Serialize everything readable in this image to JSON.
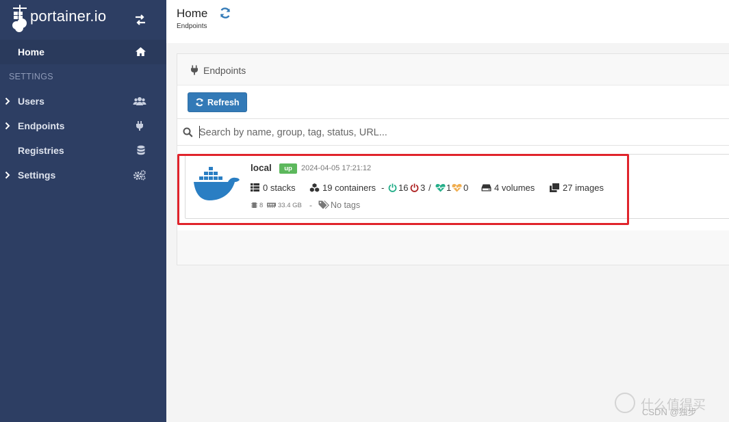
{
  "brand": {
    "name": "portainer.io"
  },
  "sidebar": {
    "home_label": "Home",
    "settings_header": "SETTINGS",
    "items": [
      {
        "label": "Users",
        "icon": "users-icon",
        "expandable": true
      },
      {
        "label": "Endpoints",
        "icon": "plug-icon",
        "expandable": true
      },
      {
        "label": "Registries",
        "icon": "database-icon",
        "expandable": false
      },
      {
        "label": "Settings",
        "icon": "cogs-icon",
        "expandable": true
      }
    ]
  },
  "header": {
    "title": "Home",
    "breadcrumb": "Endpoints"
  },
  "panel": {
    "title": "Endpoints",
    "refresh_label": "Refresh",
    "search_placeholder": "Search by name, group, tag, status, URL..."
  },
  "endpoint": {
    "name": "local",
    "status": "up",
    "timestamp": "2024-04-05 17:21:12",
    "stacks": "0 stacks",
    "containers": "19 containers",
    "separator": "-",
    "running": "16",
    "stopped": "3",
    "slash": "/",
    "healthy": "1",
    "unhealthy": "0",
    "volumes": "4 volumes",
    "images": "27 images",
    "cpu": "8",
    "memory": "33.4 GB",
    "tags_sep": "-",
    "tags": "No tags"
  },
  "colors": {
    "sidebar_bg": "#2d3e63",
    "primary": "#337ab7",
    "status_up": "#5cb85c",
    "running": "#23ae89",
    "stopped": "#ae2323",
    "healthy": "#23ae89",
    "unhealthy": "#f0ad4e",
    "highlight": "#e0232b",
    "docker_blue": "#2a7ec3"
  },
  "watermark": {
    "line1": "什么值得买",
    "line2": "CSDN @独步"
  }
}
